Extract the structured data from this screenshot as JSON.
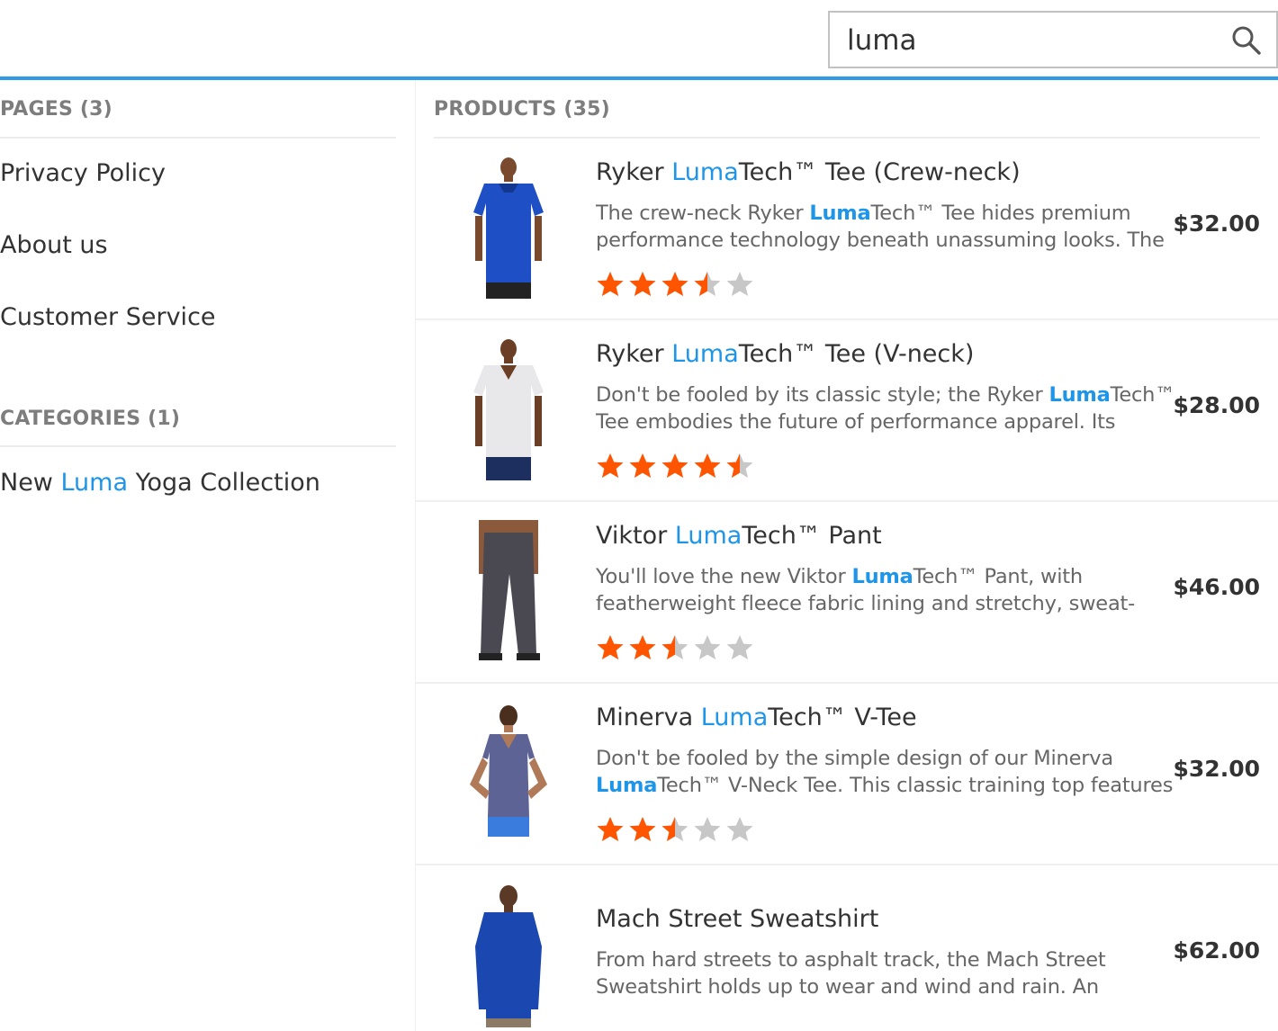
{
  "search": {
    "value": "luma",
    "icon": "search-icon"
  },
  "colors": {
    "accent": "#2d9be5",
    "highlight": "#1f95e8",
    "star_on": "#ff5501",
    "star_off": "#c7c7c7"
  },
  "pages": {
    "title": "PAGES (3)",
    "items": [
      "Privacy Policy",
      "About us",
      "Customer Service"
    ]
  },
  "categories": {
    "title": "CATEGORIES (1)",
    "items": [
      {
        "before": "New ",
        "highlight": "Luma",
        "after": " Yoga Collection"
      }
    ]
  },
  "products": {
    "title": "PRODUCTS (35)",
    "items": [
      {
        "name_before": "Ryker ",
        "name_hl": "Luma",
        "name_after": "Tech™ Tee (Crew-neck)",
        "desc_before": "The crew-neck Ryker ",
        "desc_hl": "Luma",
        "desc_after": "Tech™ Tee hides premium performance technology beneath unassuming looks. The",
        "price": "$32.00",
        "rating": 3.5,
        "image": "blue-tshirt-man"
      },
      {
        "name_before": "Ryker ",
        "name_hl": "Luma",
        "name_after": "Tech™ Tee (V-neck)",
        "desc_before": "Don't be fooled by its classic style; the Ryker ",
        "desc_hl": "Luma",
        "desc_after": "Tech™ Tee embodies the future of performance apparel. Its",
        "price": "$28.00",
        "rating": 4.5,
        "image": "white-tshirt-man"
      },
      {
        "name_before": "Viktor ",
        "name_hl": "Luma",
        "name_after": "Tech™ Pant",
        "desc_before": "You'll love the new Viktor ",
        "desc_hl": "Luma",
        "desc_after": "Tech™ Pant, with featherweight fleece fabric lining and stretchy, sweat-",
        "price": "$46.00",
        "rating": 2.5,
        "image": "grey-pants"
      },
      {
        "name_before": "Minerva ",
        "name_hl": "Luma",
        "name_after": "Tech™ V-Tee",
        "desc_before": "Don't be fooled by the simple design of our Minerva ",
        "desc_hl": "Luma",
        "desc_after": "Tech™ V-Neck Tee. This classic training top features",
        "price": "$32.00",
        "rating": 2.5,
        "image": "purple-vtee-woman"
      },
      {
        "name_before": "Mach Street Sweatshirt",
        "name_hl": "",
        "name_after": "",
        "desc_before": "From hard streets to asphalt track, the Mach Street Sweatshirt holds up to wear and wind and rain. An",
        "desc_hl": "",
        "desc_after": "",
        "price": "$62.00",
        "rating": null,
        "image": "blue-sweatshirt-man"
      }
    ]
  }
}
